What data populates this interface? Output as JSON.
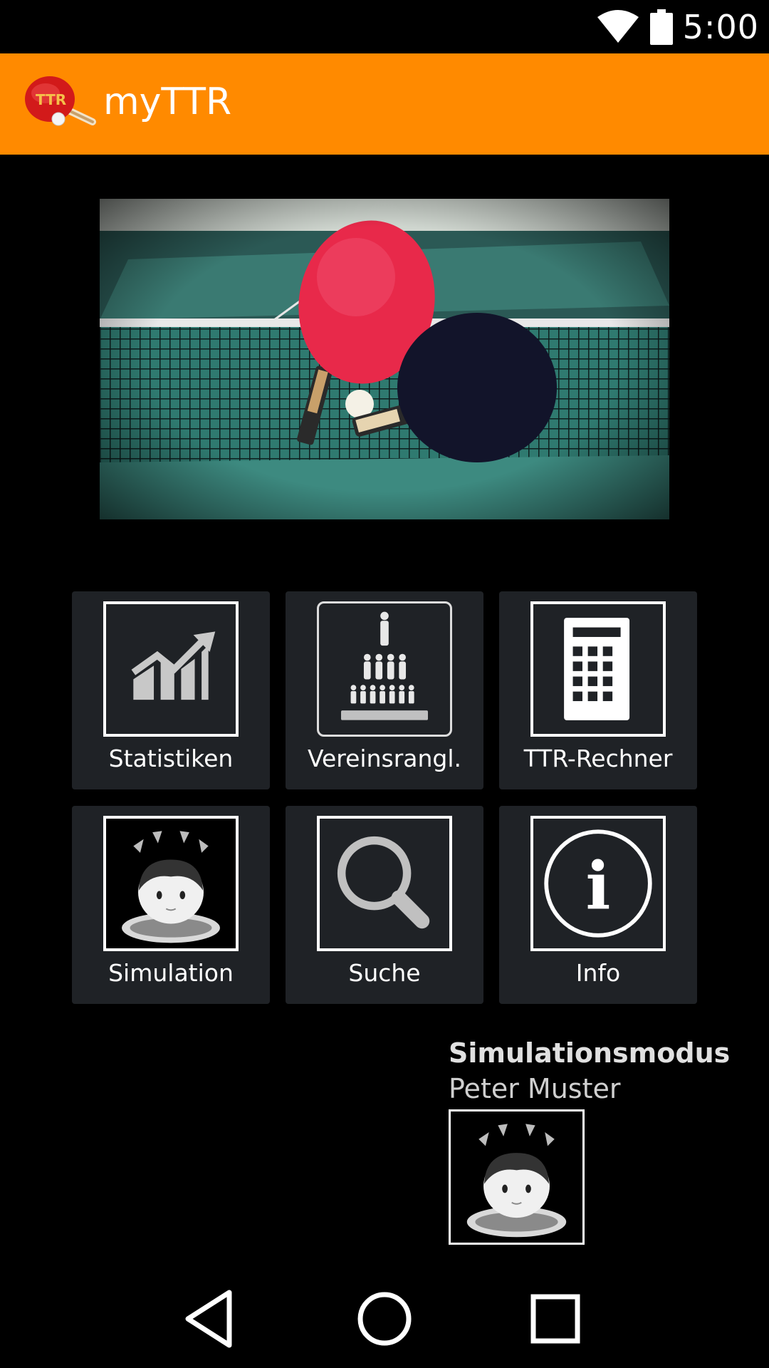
{
  "status_bar": {
    "time": "5:00",
    "icons": [
      "wifi-icon",
      "battery-icon"
    ]
  },
  "app_bar": {
    "title": "myTTR",
    "logo_icon": "ttr-paddle-logo"
  },
  "hero": {
    "image": "table-tennis-paddles-photo"
  },
  "tiles": [
    {
      "label": "Statistiken",
      "icon": "statistics-chart-icon"
    },
    {
      "label": "Vereinsrangl.",
      "icon": "club-ranking-pyramid-icon"
    },
    {
      "label": "TTR-Rechner",
      "icon": "calculator-icon"
    },
    {
      "label": "Simulation",
      "icon": "simulation-person-icon"
    },
    {
      "label": "Suche",
      "icon": "search-icon"
    },
    {
      "label": "Info",
      "icon": "info-icon"
    }
  ],
  "simulation": {
    "mode_label": "Simulationsmodus",
    "user_name": "Peter Muster"
  },
  "nav_bar": {
    "buttons": [
      "back-icon",
      "home-icon",
      "recents-icon"
    ]
  },
  "colors": {
    "app_bar": "#ff8a00",
    "tile_bg": "#1f2226",
    "background": "#000000"
  }
}
